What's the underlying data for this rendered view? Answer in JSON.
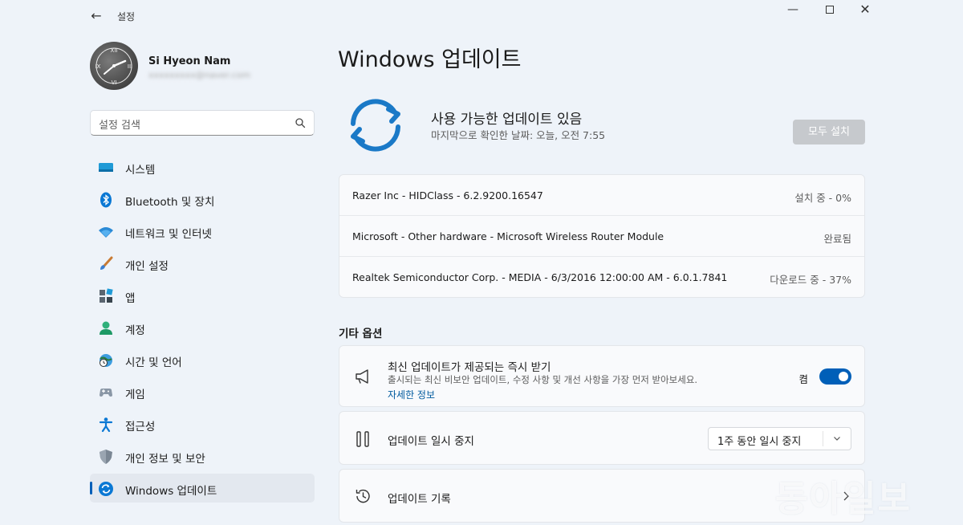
{
  "window": {
    "app_title": "설정",
    "back_icon": "back-arrow-icon",
    "minimize_icon": "minimize-icon",
    "maximize_icon": "maximize-icon",
    "close_icon": "close-icon"
  },
  "profile": {
    "name": "Si Hyeon Nam",
    "email": "xxxxxxxxx@naver.com"
  },
  "search": {
    "placeholder": "설정 검색",
    "icon": "search-icon"
  },
  "nav": {
    "items": [
      {
        "label": "시스템",
        "icon": "system-icon"
      },
      {
        "label": "Bluetooth 및 장치",
        "icon": "bluetooth-icon"
      },
      {
        "label": "네트워크 및 인터넷",
        "icon": "wifi-icon"
      },
      {
        "label": "개인 설정",
        "icon": "brush-icon"
      },
      {
        "label": "앱",
        "icon": "apps-icon"
      },
      {
        "label": "계정",
        "icon": "account-icon"
      },
      {
        "label": "시간 및 언어",
        "icon": "globe-clock-icon"
      },
      {
        "label": "게임",
        "icon": "gamepad-icon"
      },
      {
        "label": "접근성",
        "icon": "accessibility-icon"
      },
      {
        "label": "개인 정보 및 보안",
        "icon": "shield-icon"
      },
      {
        "label": "Windows 업데이트",
        "icon": "windows-update-icon",
        "active": true
      }
    ]
  },
  "main": {
    "page_title": "Windows 업데이트",
    "hero": {
      "title": "사용 가능한 업데이트 있음",
      "subtitle": "마지막으로 확인한 날짜: 오늘, 오전 7:55",
      "install_all_label": "모두 설치",
      "icon": "sync-icon"
    },
    "updates": [
      {
        "name": "Razer Inc - HIDClass - 6.2.9200.16547",
        "status": "설치 중 - 0%"
      },
      {
        "name": "Microsoft - Other hardware - Microsoft Wireless Router Module",
        "status": "완료됨"
      },
      {
        "name": "Realtek Semiconductor Corp. - MEDIA - 6/3/2016 12:00:00 AM - 6.0.1.7841",
        "status": "다운로드 중 - 37%"
      }
    ],
    "other_options": {
      "title": "기타 옵션",
      "insider": {
        "title": "최신 업데이트가 제공되는 즉시 받기",
        "description": "출시되는 최신 비보안 업데이트, 수정 사항 및 개선 사항을 가장 먼저 받아보세요.",
        "link": "자세한 정보",
        "toggle_label": "켬",
        "toggle_on": true,
        "icon": "megaphone-icon"
      },
      "pause": {
        "title": "업데이트 일시 중지",
        "selected": "1주 동안 일시 중지",
        "icon": "pause-icon"
      },
      "history": {
        "title": "업데이트 기록",
        "icon": "history-icon"
      }
    }
  },
  "watermark": "동아일보",
  "colors": {
    "accent": "#005fb8",
    "background": "#eef3f9",
    "card": "#f9fafc"
  }
}
